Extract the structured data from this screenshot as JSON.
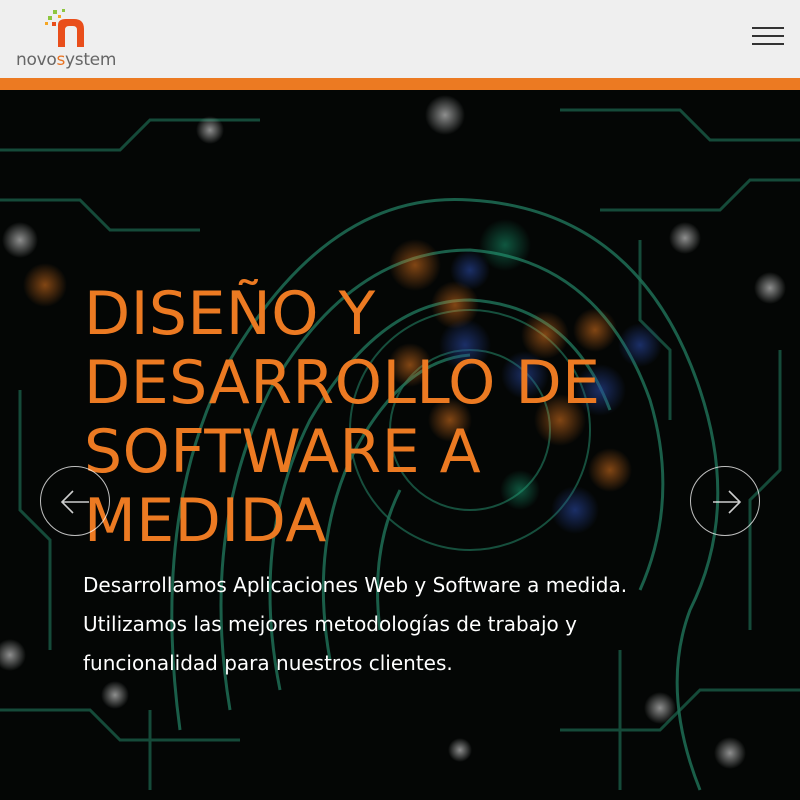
{
  "header": {
    "logo": {
      "prefix": "novo",
      "accent": "s",
      "suffix": "ystem"
    },
    "menu_icon": "hamburger-menu-icon"
  },
  "hero": {
    "title": "Diseño y desarrollo de software a medida",
    "description": "Desarrollamos Aplicaciones Web y Software a medida. Utilizamos las mejores metodologías de trabajo y funcionalidad para nuestros clientes.",
    "prev_icon": "arrow-left-icon",
    "next_icon": "arrow-right-icon"
  },
  "colors": {
    "brand_orange": "#ec7a22",
    "header_bg": "#efefef",
    "circuit_green": "#1f6e55"
  }
}
